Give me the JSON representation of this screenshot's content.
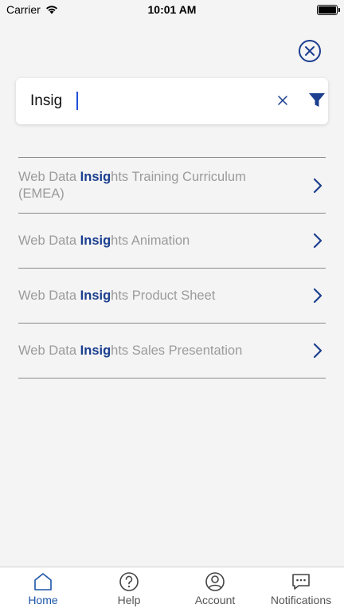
{
  "status_bar": {
    "carrier": "Carrier",
    "time": "10:01 AM"
  },
  "search": {
    "value": "Insig",
    "placeholder": ""
  },
  "results": [
    {
      "prefix": "Web Data ",
      "match": "Insig",
      "suffix": "hts Training Curriculum (EMEA)"
    },
    {
      "prefix": "Web Data ",
      "match": "Insig",
      "suffix": "hts Animation"
    },
    {
      "prefix": "Web Data ",
      "match": "Insig",
      "suffix": "hts Product Sheet"
    },
    {
      "prefix": "Web Data ",
      "match": "Insig",
      "suffix": "hts Sales Presentation"
    }
  ],
  "tabs": [
    {
      "label": "Home",
      "icon": "home-icon",
      "active": true
    },
    {
      "label": "Help",
      "icon": "help-icon",
      "active": false
    },
    {
      "label": "Account",
      "icon": "account-icon",
      "active": false
    },
    {
      "label": "Notifications",
      "icon": "notifications-icon",
      "active": false
    }
  ],
  "colors": {
    "accent": "#1c3f8f",
    "tab_active": "#1c55a8",
    "muted_text": "#9b9b9b"
  }
}
